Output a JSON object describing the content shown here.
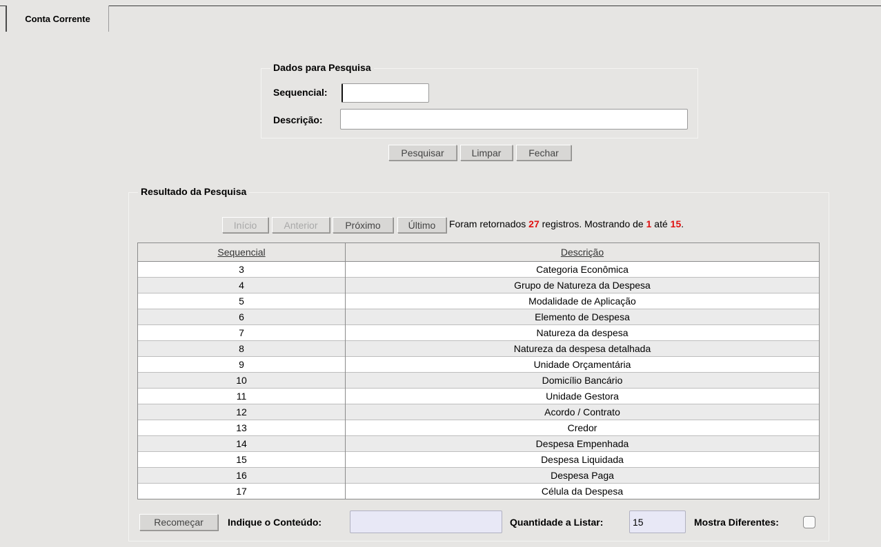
{
  "tab": {
    "label": "Conta Corrente"
  },
  "search": {
    "legend": "Dados para Pesquisa",
    "sequencial_label": "Sequencial:",
    "sequencial_value": "",
    "descricao_label": "Descrição:",
    "descricao_value": "",
    "buttons": {
      "pesquisar": "Pesquisar",
      "limpar": "Limpar",
      "fechar": "Fechar"
    }
  },
  "results": {
    "legend": "Resultado da Pesquisa",
    "pagination": {
      "inicio": "Início",
      "anterior": "Anterior",
      "proximo": "Próximo",
      "ultimo": "Último"
    },
    "status": {
      "prefix": "Foram retornados ",
      "total": "27",
      "middle": " registros. Mostrando de ",
      "from": "1",
      "until_word": " até ",
      "to": "15",
      "suffix": "."
    },
    "columns": [
      "Sequencial",
      "Descrição"
    ],
    "rows": [
      [
        "3",
        "Categoria Econômica"
      ],
      [
        "4",
        "Grupo de Natureza da Despesa"
      ],
      [
        "5",
        "Modalidade de Aplicação"
      ],
      [
        "6",
        "Elemento de Despesa"
      ],
      [
        "7",
        "Natureza da despesa"
      ],
      [
        "8",
        "Natureza da despesa detalhada"
      ],
      [
        "9",
        "Unidade Orçamentária"
      ],
      [
        "10",
        "Domicílio Bancário"
      ],
      [
        "11",
        "Unidade Gestora"
      ],
      [
        "12",
        "Acordo / Contrato"
      ],
      [
        "13",
        "Credor"
      ],
      [
        "14",
        "Despesa Empenhada"
      ],
      [
        "15",
        "Despesa Liquidada"
      ],
      [
        "16",
        "Despesa Paga"
      ],
      [
        "17",
        "Célula da Despesa"
      ]
    ]
  },
  "footer": {
    "recomecar": "Recomeçar",
    "conteudo_label": "Indique o Conteúdo:",
    "conteudo_value": "",
    "quantidade_label": "Quantidade a Listar:",
    "quantidade_value": "15",
    "mostra_label": "Mostra Diferentes:"
  }
}
